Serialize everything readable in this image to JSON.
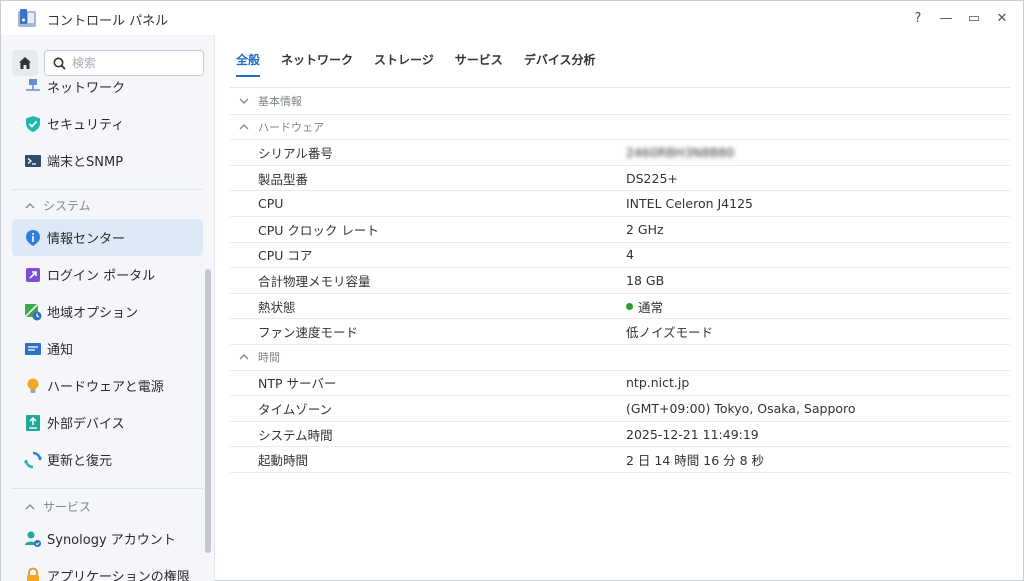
{
  "window": {
    "title": "コントロール パネル",
    "buttons": {
      "help": "?",
      "minimize": "—",
      "maximize": "▭",
      "close": "✕"
    }
  },
  "search": {
    "placeholder": "検索",
    "value": ""
  },
  "sidebar": {
    "items": [
      {
        "label": "ネットワーク",
        "icon": "network-icon"
      },
      {
        "label": "セキュリティ",
        "icon": "shield-icon"
      },
      {
        "label": "端末とSNMP",
        "icon": "terminal-icon"
      },
      {
        "group": "システム"
      },
      {
        "label": "情報センター",
        "icon": "info-icon",
        "active": true
      },
      {
        "label": "ログイン ポータル",
        "icon": "login-portal-icon"
      },
      {
        "label": "地域オプション",
        "icon": "region-icon"
      },
      {
        "label": "通知",
        "icon": "notification-icon"
      },
      {
        "label": "ハードウェアと電源",
        "icon": "bulb-icon"
      },
      {
        "label": "外部デバイス",
        "icon": "external-device-icon"
      },
      {
        "label": "更新と復元",
        "icon": "update-icon"
      },
      {
        "group": "サービス"
      },
      {
        "label": "Synology アカウント",
        "icon": "account-icon"
      },
      {
        "label": "アプリケーションの権限",
        "icon": "lock-icon"
      }
    ]
  },
  "tabs": [
    {
      "label": "全般",
      "active": true
    },
    {
      "label": "ネットワーク"
    },
    {
      "label": "ストレージ"
    },
    {
      "label": "サービス"
    },
    {
      "label": "デバイス分析"
    }
  ],
  "sections": {
    "basic": {
      "label": "基本情報",
      "expanded": false
    },
    "hardware": {
      "label": "ハードウェア",
      "expanded": true,
      "rows": [
        {
          "key": "シリアル番号",
          "value": "2460RBH3N8B80",
          "blurred": true
        },
        {
          "key": "製品型番",
          "value": "DS225+"
        },
        {
          "key": "CPU",
          "value": "INTEL Celeron J4125"
        },
        {
          "key": "CPU クロック レート",
          "value": "2 GHz"
        },
        {
          "key": "CPU コア",
          "value": "4"
        },
        {
          "key": "合計物理メモリ容量",
          "value": "18 GB"
        },
        {
          "key": "熱状態",
          "value": "通常",
          "status": "ok"
        },
        {
          "key": "ファン速度モード",
          "value": "低ノイズモード"
        }
      ]
    },
    "time": {
      "label": "時間",
      "expanded": true,
      "rows": [
        {
          "key": "NTP サーバー",
          "value": "ntp.nict.jp"
        },
        {
          "key": "タイムゾーン",
          "value": "(GMT+09:00) Tokyo, Osaka, Sapporo"
        },
        {
          "key": "システム時間",
          "value": "2025-12-21 11:49:19"
        },
        {
          "key": "起動時間",
          "value": "2 日 14 時間 16 分 8 秒"
        }
      ]
    }
  },
  "colors": {
    "accent": "#1f6fc6",
    "status_ok": "#2aa02a",
    "sidebar_active": "#dde9f7"
  }
}
